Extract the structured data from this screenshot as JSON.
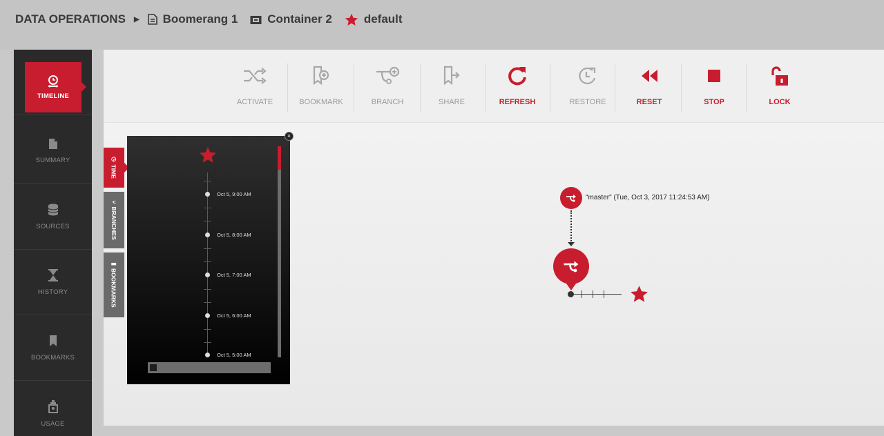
{
  "breadcrumb": {
    "root": "DATA OPERATIONS",
    "items": [
      {
        "label": "Boomerang 1",
        "icon": "document-icon"
      },
      {
        "label": "Container 2",
        "icon": "container-icon"
      },
      {
        "label": "default",
        "icon": "star-icon"
      }
    ]
  },
  "nav": {
    "items": [
      {
        "label": "TIMELINE",
        "icon": "timeline-icon",
        "active": true
      },
      {
        "label": "SUMMARY",
        "icon": "document-icon"
      },
      {
        "label": "SOURCES",
        "icon": "database-icon"
      },
      {
        "label": "HISTORY",
        "icon": "hourglass-icon"
      },
      {
        "label": "BOOKMARKS",
        "icon": "bookmark-icon"
      },
      {
        "label": "USAGE",
        "icon": "usage-icon"
      }
    ]
  },
  "toolbar": {
    "activate": "ACTIVATE",
    "bookmark": "BOOKMARK",
    "branch": "BRANCH",
    "share": "SHARE",
    "refresh": "REFRESH",
    "restore": "RESTORE",
    "reset": "RESET",
    "stop": "STOP",
    "lock": "LOCK"
  },
  "sidetabs": {
    "time": "TIME",
    "branches": "BRANCHES",
    "bookmarks": "BOOKMARKS"
  },
  "timeline": {
    "entries": [
      "Oct 5, 9:00 AM",
      "Oct 5, 8:00 AM",
      "Oct 5, 7:00 AM",
      "Oct 5, 6:00 AM",
      "Oct 5, 5:00 AM"
    ]
  },
  "graph": {
    "master_label": "\"master\" (Tue, Oct 3, 2017 11:24:53 AM)"
  },
  "colors": {
    "accent": "#c81d2e",
    "nav_bg": "#2a2a2a",
    "header_bg": "#c4c4c4",
    "disabled": "#9a9a9a"
  }
}
